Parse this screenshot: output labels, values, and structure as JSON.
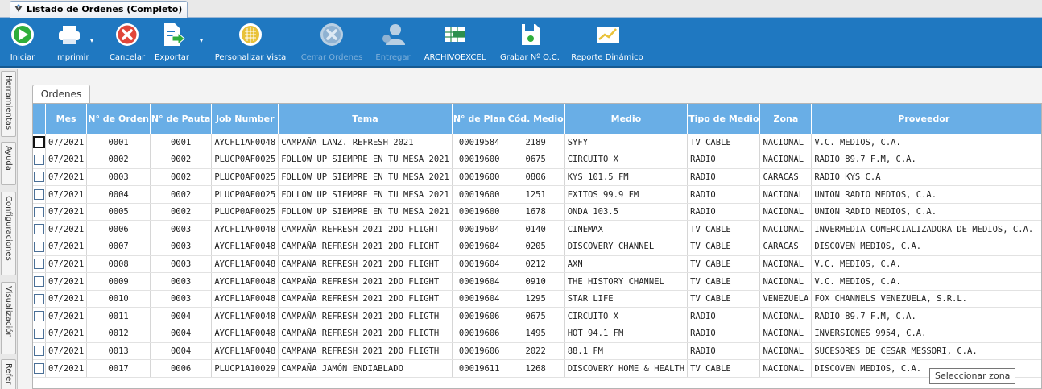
{
  "window": {
    "title": "Listado de Ordenes (Completo)"
  },
  "toolbar": [
    {
      "name": "iniciar-button",
      "icon": "play-icon",
      "label": "Iniciar",
      "enabled": true
    },
    {
      "name": "imprimir-button",
      "icon": "printer-icon",
      "label": "Imprimir",
      "enabled": true
    },
    {
      "name": "cancelar-button",
      "icon": "cancel-icon",
      "label": "Cancelar",
      "enabled": true
    },
    {
      "name": "exportar-button",
      "icon": "export-icon",
      "label": "Exportar",
      "enabled": true
    },
    {
      "name": "personalizar-vista-button",
      "icon": "grid-globe-icon",
      "label": "Personalizar Vista",
      "enabled": true
    },
    {
      "name": "cerrar-ordenes-button",
      "icon": "close-circle-icon",
      "label": "Cerrar Ordenes",
      "enabled": false
    },
    {
      "name": "entregar-button",
      "icon": "deliver-user-icon",
      "label": "Entregar",
      "enabled": false
    },
    {
      "name": "archivo-excel-button",
      "icon": "excel-icon",
      "label": "ARCHIVOEXCEL",
      "enabled": true
    },
    {
      "name": "grabar-noc-button",
      "icon": "save-icon",
      "label": "Grabar Nº O.C.",
      "enabled": true
    },
    {
      "name": "reporte-dinamico-button",
      "icon": "chart-icon",
      "label": "Reporte Dinámico",
      "enabled": true
    }
  ],
  "side_tabs": [
    "Herramientas",
    "Ayuda",
    "Configuraciones",
    "Visualización",
    "Refer"
  ],
  "panel": {
    "tab_label": "Ordenes"
  },
  "table": {
    "columns": [
      "",
      "Mes",
      "N° de Orden",
      "N° de Pauta",
      "Job Number",
      "Tema",
      "N° de Plan",
      "Cód. Medio",
      "Medio",
      "Tipo de Medio",
      "Zona",
      "Proveedor"
    ],
    "rows": [
      [
        "07/2021",
        "0001",
        "0001",
        "AYCFL1AF0048",
        "CAMPAÑA LANZ. REFRESH 2021",
        "00019584",
        "2189",
        "SYFY",
        "TV CABLE",
        "NACIONAL",
        "V.C. MEDIOS, C.A."
      ],
      [
        "07/2021",
        "0002",
        "0002",
        "PLUCP0AF0025",
        "FOLLOW UP SIEMPRE EN TU MESA 2021",
        "00019600",
        "0675",
        "CIRCUITO X",
        "RADIO",
        "NACIONAL",
        "RADIO 89.7 F.M, C.A."
      ],
      [
        "07/2021",
        "0003",
        "0002",
        "PLUCP0AF0025",
        "FOLLOW UP SIEMPRE EN TU MESA 2021",
        "00019600",
        "0806",
        "KYS 101.5 FM",
        "RADIO",
        "CARACAS",
        "RADIO KYS C.A"
      ],
      [
        "07/2021",
        "0004",
        "0002",
        "PLUCP0AF0025",
        "FOLLOW UP SIEMPRE EN TU MESA 2021",
        "00019600",
        "1251",
        "EXITOS 99.9 FM",
        "RADIO",
        "NACIONAL",
        "UNION RADIO MEDIOS, C.A."
      ],
      [
        "07/2021",
        "0005",
        "0002",
        "PLUCP0AF0025",
        "FOLLOW UP SIEMPRE EN TU MESA 2021",
        "00019600",
        "1678",
        "ONDA 103.5",
        "RADIO",
        "NACIONAL",
        "UNION RADIO MEDIOS, C.A."
      ],
      [
        "07/2021",
        "0006",
        "0003",
        "AYCFL1AF0048",
        "CAMPAÑA REFRESH 2021 2DO FLIGHT",
        "00019604",
        "0140",
        "CINEMAX",
        "TV CABLE",
        "NACIONAL",
        "INVERMEDIA COMERCIALIZADORA DE MEDIOS, C.A."
      ],
      [
        "07/2021",
        "0007",
        "0003",
        "AYCFL1AF0048",
        "CAMPAÑA REFRESH 2021 2DO FLIGHT",
        "00019604",
        "0205",
        "DISCOVERY CHANNEL",
        "TV CABLE",
        "CARACAS",
        "DISCOVEN MEDIOS, C.A."
      ],
      [
        "07/2021",
        "0008",
        "0003",
        "AYCFL1AF0048",
        "CAMPAÑA REFRESH 2021 2DO FLIGHT",
        "00019604",
        "0212",
        "AXN",
        "TV CABLE",
        "NACIONAL",
        "V.C. MEDIOS, C.A."
      ],
      [
        "07/2021",
        "0009",
        "0003",
        "AYCFL1AF0048",
        "CAMPAÑA REFRESH 2021 2DO FLIGHT",
        "00019604",
        "0910",
        "THE HISTORY CHANNEL",
        "TV CABLE",
        "NACIONAL",
        "V.C. MEDIOS, C.A."
      ],
      [
        "07/2021",
        "0010",
        "0003",
        "AYCFL1AF0048",
        "CAMPAÑA REFRESH 2021 2DO FLIGHT",
        "00019604",
        "1295",
        "STAR LIFE",
        "TV CABLE",
        "VENEZUELA",
        "FOX CHANNELS VENEZUELA, S.R.L."
      ],
      [
        "07/2021",
        "0011",
        "0004",
        "AYCFL1AF0048",
        "CAMPAÑA REFRESH 2021 2DO FLIGTH",
        "00019606",
        "0675",
        "CIRCUITO X",
        "RADIO",
        "NACIONAL",
        "RADIO 89.7 F.M, C.A."
      ],
      [
        "07/2021",
        "0012",
        "0004",
        "AYCFL1AF0048",
        "CAMPAÑA REFRESH 2021 2DO FLIGTH",
        "00019606",
        "1495",
        "HOT 94.1 FM",
        "RADIO",
        "NACIONAL",
        "INVERSIONES 9954, C.A."
      ],
      [
        "07/2021",
        "0013",
        "0004",
        "AYCFL1AF0048",
        "CAMPAÑA REFRESH 2021 2DO FLIGTH",
        "00019606",
        "2022",
        "88.1 FM",
        "RADIO",
        "NACIONAL",
        "SUCESORES DE CESAR MESSORI, C.A."
      ],
      [
        "07/2021",
        "0017",
        "0006",
        "PLUCP1A10029",
        "CAMPAÑA JAMÓN ENDIABLADO",
        "00019611",
        "1268",
        "DISCOVERY HOME & HEALTH",
        "TV CABLE",
        "NACIONAL",
        "DISCOVEN MEDIOS, C.A."
      ]
    ]
  },
  "tooltip": "Seleccionar zona"
}
